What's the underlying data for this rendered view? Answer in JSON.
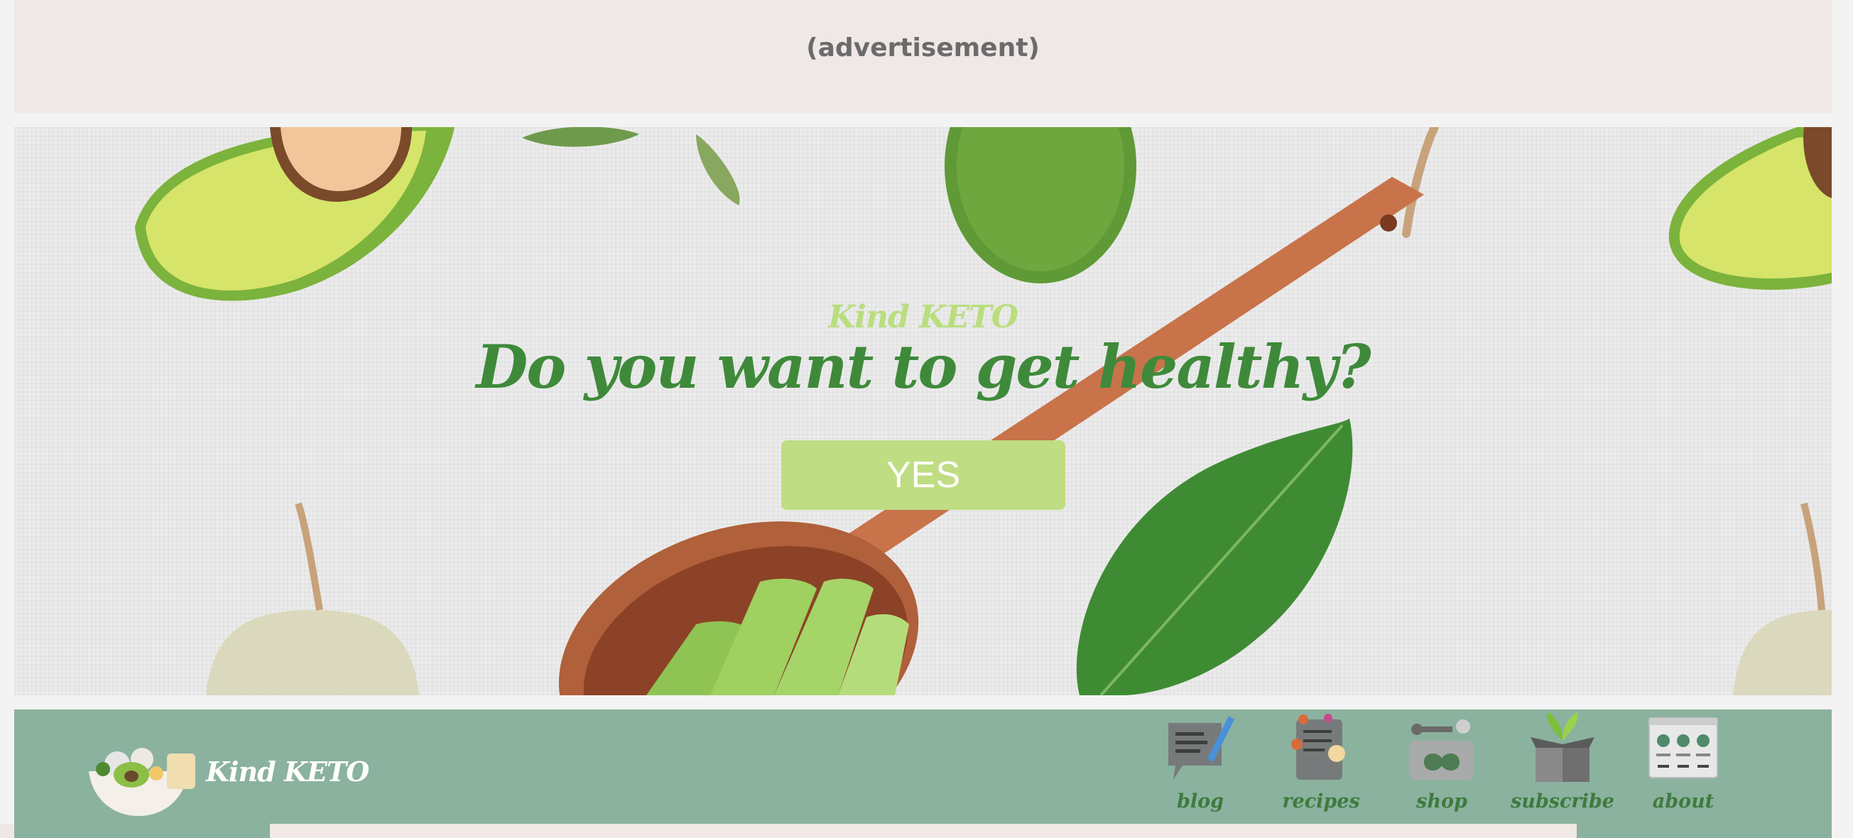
{
  "advertisement": {
    "label": "(advertisement)"
  },
  "hero": {
    "brand": "Kind KETO",
    "headline": "Do you want to get healthy?",
    "cta_label": "YES"
  },
  "navbar": {
    "logo_text": "Kind KETO",
    "items": [
      {
        "label": "blog",
        "icon": "blog-icon"
      },
      {
        "label": "recipes",
        "icon": "recipes-icon"
      },
      {
        "label": "shop",
        "icon": "shop-icon"
      },
      {
        "label": "subscribe",
        "icon": "subscribe-icon"
      },
      {
        "label": "about",
        "icon": "about-icon"
      }
    ]
  },
  "colors": {
    "accent_green": "#3e8a3a",
    "light_green": "#bfdd82",
    "nav_background": "#8bb29f",
    "ad_background": "#efe8e6"
  }
}
